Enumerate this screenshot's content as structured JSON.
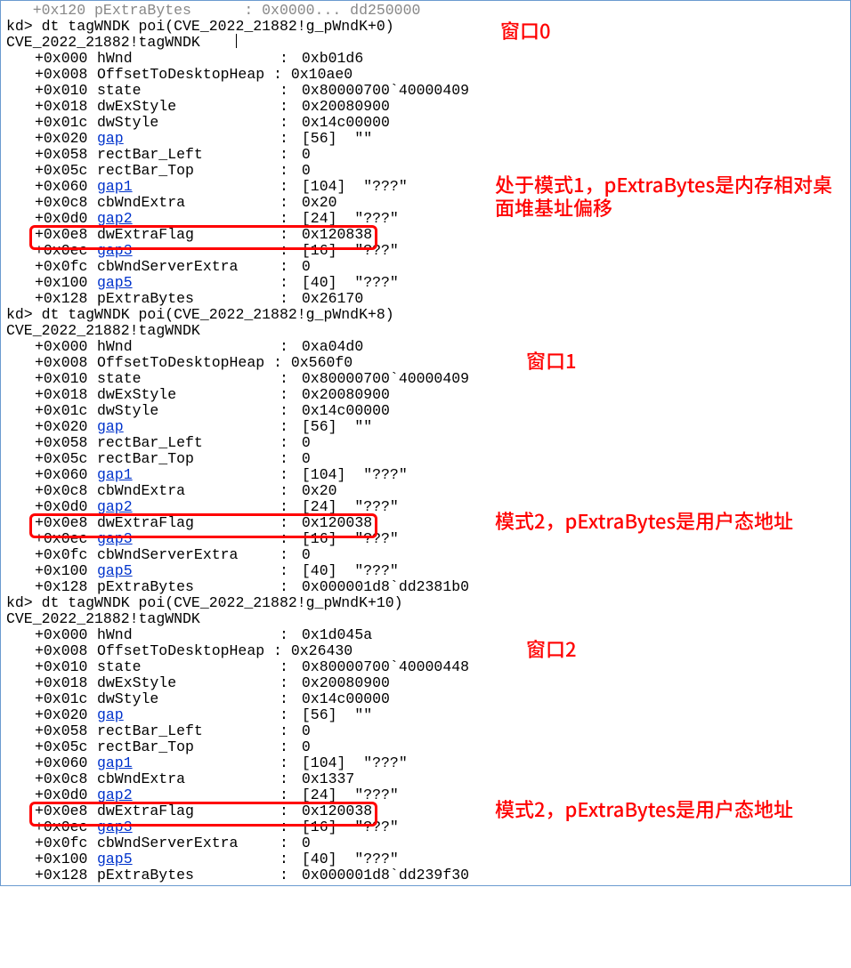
{
  "prompts": [
    "kd> dt tagWNDK poi(CVE_2022_21882!g_pWndK+0)",
    "kd> dt tagWNDK poi(CVE_2022_21882!g_pWndK+8)",
    "kd> dt tagWNDK poi(CVE_2022_21882!g_pWndK+10)"
  ],
  "struct_hdr": "CVE_2022_21882!tagWNDK",
  "truncated_top": "   +0x120 pExtraBytes      : 0x0000... dd250000",
  "labels": {
    "w0": "窗口0",
    "w1": "窗口1",
    "w2": "窗口2"
  },
  "annot1": "处于模式1，pExtraBytes是内存相对桌面堆基址偏移",
  "annot2": "模式2，pExtraBytes是用户态地址",
  "annot3": "模式2，pExtraBytes是用户态地址",
  "rows": [
    {
      "off": "+0x000",
      "name": "hWnd",
      "val": "0xb01d6"
    },
    {
      "off": "+0x008",
      "name": "OffsetToDesktopHeap",
      "val": "0x10ae0",
      "midcolon": true
    },
    {
      "off": "+0x010",
      "name": "state",
      "val": "0x80000700`40000409"
    },
    {
      "off": "+0x018",
      "name": "dwExStyle",
      "val": "0x20080900"
    },
    {
      "off": "+0x01c",
      "name": "dwStyle",
      "val": "0x14c00000"
    },
    {
      "off": "+0x020",
      "name": "gap",
      "val": "[56]  \"\"",
      "link": true
    },
    {
      "off": "+0x058",
      "name": "rectBar_Left",
      "val": "0"
    },
    {
      "off": "+0x05c",
      "name": "rectBar_Top",
      "val": "0"
    },
    {
      "off": "+0x060",
      "name": "gap1",
      "val": "[104]  \"???\"",
      "link": true
    },
    {
      "off": "+0x0c8",
      "name": "cbWndExtra",
      "val": "0x20"
    },
    {
      "off": "+0x0d0",
      "name": "gap2",
      "val": "[24]  \"???\"",
      "link": true
    },
    {
      "off": "+0x0e8",
      "name": "dwExtraFlag",
      "val": "0x120838",
      "hl": true
    },
    {
      "off": "+0x0ec",
      "name": "gap3",
      "val": "[16]  \"???\"",
      "link": true
    },
    {
      "off": "+0x0fc",
      "name": "cbWndServerExtra",
      "val": "0"
    },
    {
      "off": "+0x100",
      "name": "gap5",
      "val": "[40]  \"???\"",
      "link": true
    },
    {
      "off": "+0x128",
      "name": "pExtraBytes",
      "val": "0x26170"
    }
  ],
  "rows1": [
    {
      "off": "+0x000",
      "name": "hWnd",
      "val": "0xa04d0"
    },
    {
      "off": "+0x008",
      "name": "OffsetToDesktopHeap",
      "val": "0x560f0",
      "midcolon": true
    },
    {
      "off": "+0x010",
      "name": "state",
      "val": "0x80000700`40000409"
    },
    {
      "off": "+0x018",
      "name": "dwExStyle",
      "val": "0x20080900"
    },
    {
      "off": "+0x01c",
      "name": "dwStyle",
      "val": "0x14c00000"
    },
    {
      "off": "+0x020",
      "name": "gap",
      "val": "[56]  \"\"",
      "link": true
    },
    {
      "off": "+0x058",
      "name": "rectBar_Left",
      "val": "0"
    },
    {
      "off": "+0x05c",
      "name": "rectBar_Top",
      "val": "0"
    },
    {
      "off": "+0x060",
      "name": "gap1",
      "val": "[104]  \"???\"",
      "link": true
    },
    {
      "off": "+0x0c8",
      "name": "cbWndExtra",
      "val": "0x20"
    },
    {
      "off": "+0x0d0",
      "name": "gap2",
      "val": "[24]  \"???\"",
      "link": true
    },
    {
      "off": "+0x0e8",
      "name": "dwExtraFlag",
      "val": "0x120038",
      "hl": true
    },
    {
      "off": "+0x0ec",
      "name": "gap3",
      "val": "[16]  \"???\"",
      "link": true
    },
    {
      "off": "+0x0fc",
      "name": "cbWndServerExtra",
      "val": "0"
    },
    {
      "off": "+0x100",
      "name": "gap5",
      "val": "[40]  \"???\"",
      "link": true
    },
    {
      "off": "+0x128",
      "name": "pExtraBytes",
      "val": "0x000001d8`dd2381b0"
    }
  ],
  "rows2": [
    {
      "off": "+0x000",
      "name": "hWnd",
      "val": "0x1d045a"
    },
    {
      "off": "+0x008",
      "name": "OffsetToDesktopHeap",
      "val": "0x26430",
      "midcolon": true
    },
    {
      "off": "+0x010",
      "name": "state",
      "val": "0x80000700`40000448"
    },
    {
      "off": "+0x018",
      "name": "dwExStyle",
      "val": "0x20080900"
    },
    {
      "off": "+0x01c",
      "name": "dwStyle",
      "val": "0x14c00000"
    },
    {
      "off": "+0x020",
      "name": "gap",
      "val": "[56]  \"\"",
      "link": true
    },
    {
      "off": "+0x058",
      "name": "rectBar_Left",
      "val": "0"
    },
    {
      "off": "+0x05c",
      "name": "rectBar_Top",
      "val": "0"
    },
    {
      "off": "+0x060",
      "name": "gap1",
      "val": "[104]  \"???\"",
      "link": true
    },
    {
      "off": "+0x0c8",
      "name": "cbWndExtra",
      "val": "0x1337"
    },
    {
      "off": "+0x0d0",
      "name": "gap2",
      "val": "[24]  \"???\"",
      "link": true
    },
    {
      "off": "+0x0e8",
      "name": "dwExtraFlag",
      "val": "0x120038",
      "hl": true
    },
    {
      "off": "+0x0ec",
      "name": "gap3",
      "val": "[16]  \"???\"",
      "link": true
    },
    {
      "off": "+0x0fc",
      "name": "cbWndServerExtra",
      "val": "0"
    },
    {
      "off": "+0x100",
      "name": "gap5",
      "val": "[40]  \"???\"",
      "link": true
    },
    {
      "off": "+0x128",
      "name": "pExtraBytes",
      "val": "0x000001d8`dd239f30"
    }
  ]
}
